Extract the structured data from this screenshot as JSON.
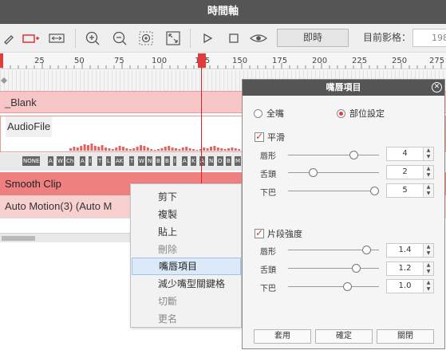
{
  "window": {
    "title": "時間軸"
  },
  "toolbar": {
    "now_label": "即時",
    "current_frame_label": "目前影格：",
    "current_frame_value": "198"
  },
  "ruler": {
    "ticks": [
      "25",
      "50",
      "75",
      "100",
      "125",
      "150",
      "175",
      "200",
      "225",
      "250",
      "275"
    ]
  },
  "tracks": {
    "blank": "_Blank",
    "audio": "AudioFile",
    "smooth": "Smooth Clip",
    "automotion": "Auto Motion(3) (Auto M"
  },
  "visemes": [
    "NONE",
    "A",
    "W",
    "Ch",
    "A",
    "I",
    "T",
    "L",
    "AK",
    "T",
    "W",
    "N",
    "B",
    "B",
    "I",
    "A",
    "K",
    "A",
    "N",
    "O",
    "B",
    "M",
    "E",
    "K",
    "I"
  ],
  "context_menu": {
    "items": [
      {
        "label": "剪下",
        "state": "normal"
      },
      {
        "label": "複製",
        "state": "normal"
      },
      {
        "label": "貼上",
        "state": "normal"
      },
      {
        "label": "刪除",
        "state": "disabled"
      },
      {
        "label": "嘴唇項目",
        "state": "active"
      },
      {
        "label": "減少嘴型關鍵格",
        "state": "normal"
      },
      {
        "label": "切斷",
        "state": "disabled"
      },
      {
        "label": "更名",
        "state": "disabled"
      }
    ]
  },
  "dialog": {
    "title": "嘴唇項目",
    "radio_all": "全嘴",
    "radio_part": "部位設定",
    "smooth_check": "平滑",
    "strength_check": "片段強度",
    "smooth_rows": [
      {
        "label": "唇形",
        "value": "4",
        "level": 0.75
      },
      {
        "label": "舌頭",
        "value": "2",
        "level": 0.25
      },
      {
        "label": "下巴",
        "value": "5",
        "level": 1.0
      }
    ],
    "strength_rows": [
      {
        "label": "唇形",
        "value": "1.4",
        "level": 0.9
      },
      {
        "label": "舌頭",
        "value": "1.2",
        "level": 0.78
      },
      {
        "label": "下巴",
        "value": "1.0",
        "level": 0.67
      }
    ],
    "apply": "套用",
    "ok": "確定",
    "close": "關閉"
  },
  "colors": {
    "accent_red": "#e23b3b",
    "track_pink": "#f7c7c7",
    "track_red": "#ef8080",
    "dark_bar": "#555555"
  }
}
